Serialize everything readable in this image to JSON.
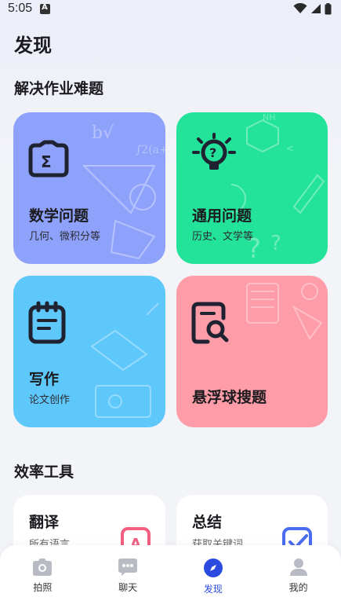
{
  "status_bar": {
    "time": "5:05"
  },
  "page": {
    "title": "发现"
  },
  "sections": {
    "homework": "解决作业难题",
    "tools": "效率工具"
  },
  "cards": {
    "math": {
      "title": "数学问题",
      "subtitle": "几何、微积分等",
      "color": "#8fa2fb"
    },
    "general": {
      "title": "通用问题",
      "subtitle": "历史、文学等",
      "color": "#23e39b"
    },
    "writing": {
      "title": "写作",
      "subtitle": "论文创作",
      "color": "#5ec8fb"
    },
    "floating": {
      "title": "悬浮球搜题",
      "color": "#fe9ca8"
    }
  },
  "tools": {
    "translate": {
      "title": "翻译",
      "subtitle": "所有语言"
    },
    "summary": {
      "title": "总结",
      "subtitle": "获取关键词"
    }
  },
  "tabbar": {
    "items": [
      {
        "label": "拍照",
        "icon": "camera-icon",
        "active": false
      },
      {
        "label": "聊天",
        "icon": "chat-icon",
        "active": false
      },
      {
        "label": "发现",
        "icon": "compass-icon",
        "active": true
      },
      {
        "label": "我的",
        "icon": "person-icon",
        "active": false
      }
    ],
    "active_color": "#2b4be0"
  }
}
